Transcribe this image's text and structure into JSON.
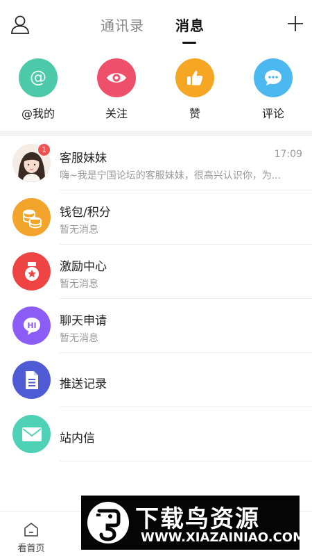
{
  "header": {
    "tabs": [
      {
        "label": "通讯录",
        "active": false
      },
      {
        "label": "消息",
        "active": true
      }
    ]
  },
  "quick_actions": [
    {
      "label": "@我的",
      "icon": "at-icon",
      "color": "#4cc9a8"
    },
    {
      "label": "关注",
      "icon": "eye-icon",
      "color": "#ee4f6a"
    },
    {
      "label": "赞",
      "icon": "thumbs-up-icon",
      "color": "#f5a623"
    },
    {
      "label": "评论",
      "icon": "comment-icon",
      "color": "#4bb8f0"
    }
  ],
  "messages": [
    {
      "title": "客服妹妹",
      "subtitle": "嗨~我是宁国论坛的客服妹妹，很高兴认识你，为...",
      "time": "17:09",
      "badge": "1",
      "icon": "avatar-photo"
    },
    {
      "title": "钱包/积分",
      "subtitle": "暂无消息",
      "icon": "coins-icon",
      "color": "#f3a52b"
    },
    {
      "title": "激励中心",
      "subtitle": "暂无消息",
      "icon": "medal-icon",
      "color": "#ef4444"
    },
    {
      "title": "聊天申请",
      "subtitle": "暂无消息",
      "icon": "chat-hi-icon",
      "color": "#8b5cf6"
    },
    {
      "title": "推送记录",
      "icon": "document-icon",
      "color": "#4f5bd5"
    },
    {
      "title": "站内信",
      "icon": "mail-icon",
      "color": "#4fd1b5"
    }
  ],
  "bottom_nav": [
    {
      "label": "看首页",
      "icon": "home-icon"
    }
  ],
  "watermark": {
    "title": "下载鸟资源",
    "url": "WWW.XIAZAINIAO.COM"
  }
}
